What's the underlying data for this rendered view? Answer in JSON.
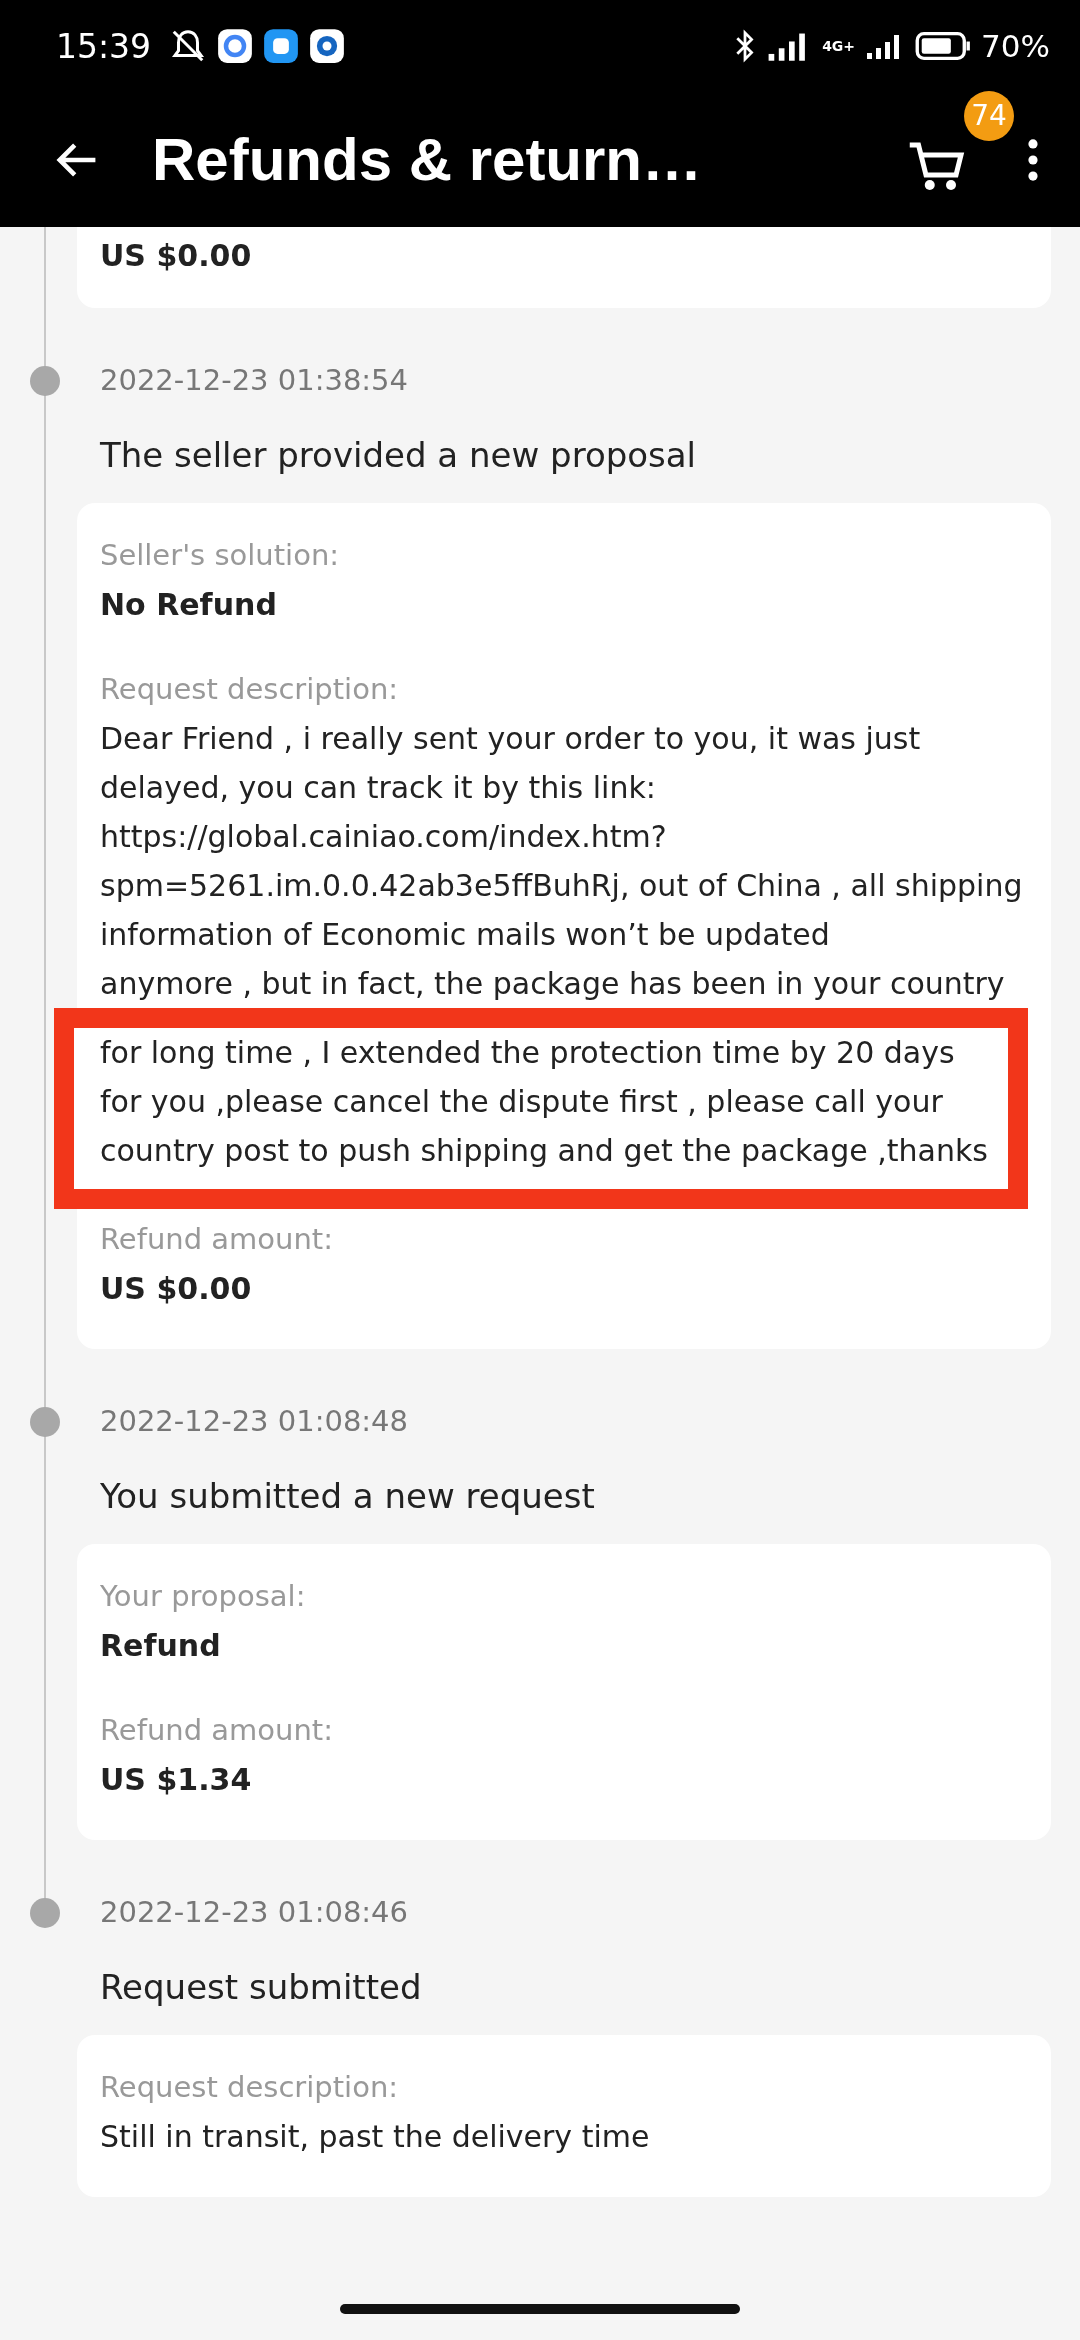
{
  "status_bar": {
    "time": "15:39",
    "network": "4G+",
    "battery": "70%"
  },
  "header": {
    "title": "Refunds & return…",
    "cart_badge": "74"
  },
  "top_card": {
    "amount": "US $0.00"
  },
  "events": [
    {
      "date": "2022-12-23 01:38:54",
      "title": "The seller provided a new proposal",
      "fields": [
        {
          "kind": "pair",
          "label": "Seller's solution:",
          "value": "No Refund",
          "bold": true
        },
        {
          "kind": "pair",
          "label": "Request description:",
          "value": "Dear Friend , i really sent your order to you, it was just delayed, you can track it by this link: https://global.cainiao.com/index.htm?spm=5261.im.0.0.42ab3e5ffBuhRj, out of China , all shipping information of Economic mails won’t be updated",
          "bold": false
        },
        {
          "kind": "cut_top",
          "text": "anymore , but in fact, the package has been in your country"
        },
        {
          "kind": "callout",
          "text": "for long time , I extended the protection time by 20 days for you ,please cancel the dispute first , please call your country post to push shipping and get the package ,thanks"
        },
        {
          "kind": "cut_bottom",
          "text": "Refund amount:"
        },
        {
          "kind": "value",
          "text": "US $0.00"
        }
      ]
    },
    {
      "date": "2022-12-23 01:08:48",
      "title": "You submitted a new request",
      "fields": [
        {
          "kind": "pair",
          "label": "Your proposal:",
          "value": "Refund",
          "bold": true
        },
        {
          "kind": "pair",
          "label": "Refund amount:",
          "value": "US $1.34",
          "bold": true
        }
      ]
    },
    {
      "date": "2022-12-23 01:08:46",
      "title": "Request submitted",
      "fields": [
        {
          "kind": "pair",
          "label": "Request description:",
          "value": "Still in transit, past the delivery time",
          "bold": false
        }
      ]
    }
  ]
}
